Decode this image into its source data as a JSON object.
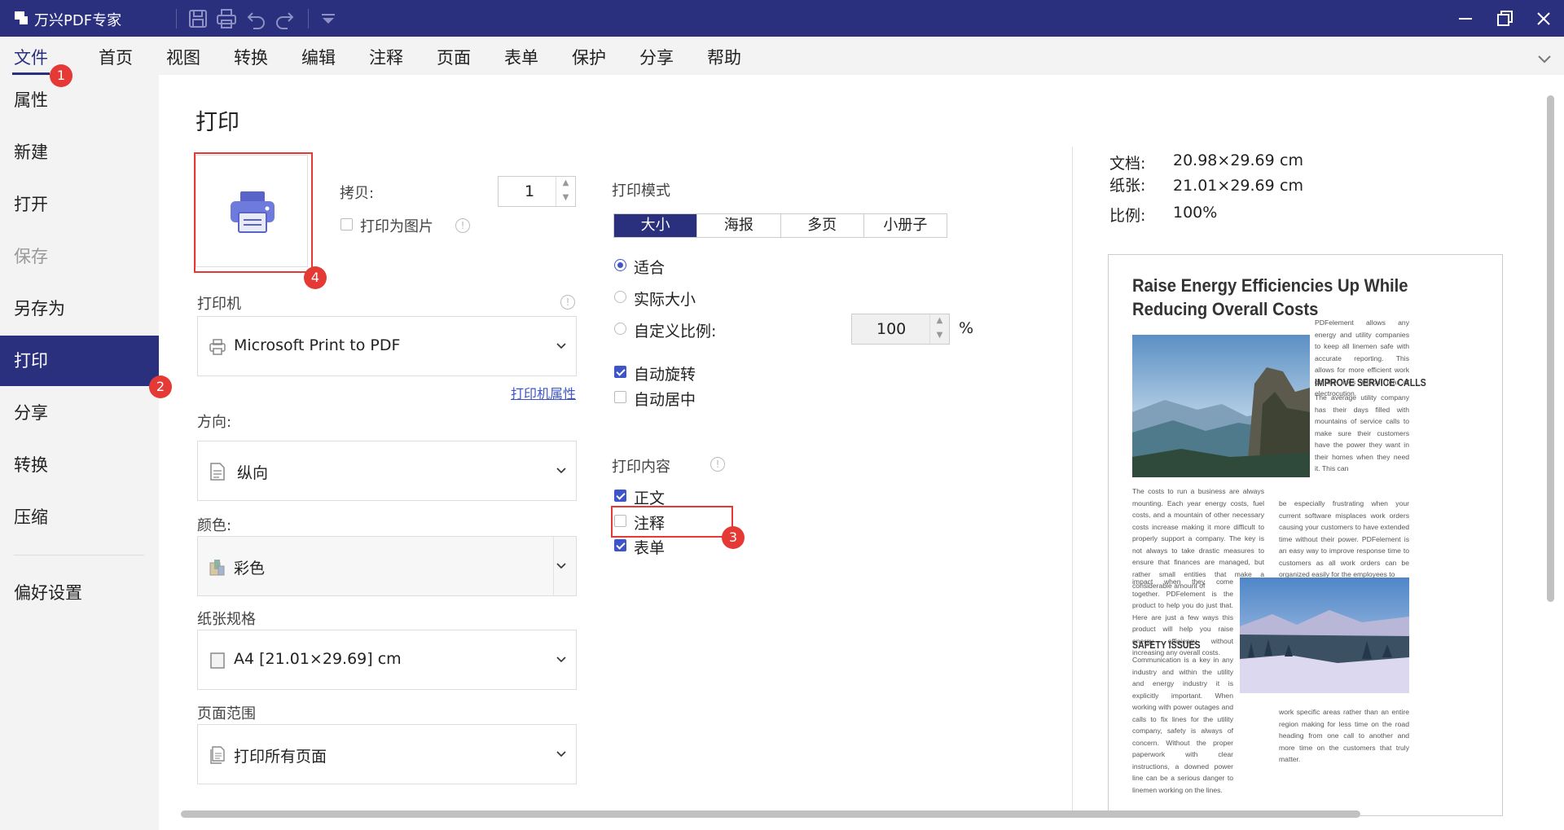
{
  "app": {
    "title": "万兴PDF专家"
  },
  "menu": [
    "文件",
    "首页",
    "视图",
    "转换",
    "编辑",
    "注释",
    "页面",
    "表单",
    "保护",
    "分享",
    "帮助"
  ],
  "sidebar": {
    "items": [
      "属性",
      "新建",
      "打开",
      "保存",
      "另存为",
      "打印",
      "分享",
      "转换",
      "压缩"
    ],
    "preferences": "偏好设置"
  },
  "badges": [
    "1",
    "2",
    "3",
    "4"
  ],
  "print": {
    "title": "打印",
    "copies_label": "拷贝:",
    "copies_value": "1",
    "print_as_image": "打印为图片",
    "printer_label": "打印机",
    "printer_value": "Microsoft Print to PDF",
    "printer_props": "打印机属性",
    "orientation_label": "方向:",
    "orientation_value": "纵向",
    "color_label": "颜色:",
    "color_value": "彩色",
    "paper_label": "纸张规格",
    "paper_value": "A4 [21.01×29.69] cm",
    "range_label": "页面范围",
    "range_value": "打印所有页面",
    "mode_label": "打印模式",
    "mode_tabs": [
      "大小",
      "海报",
      "多页",
      "小册子"
    ],
    "fit": "适合",
    "actual_size": "实际大小",
    "custom_scale": "自定义比例:",
    "scale_value": "100",
    "percent": "%",
    "auto_rotate": "自动旋转",
    "auto_center": "自动居中",
    "content_label": "打印内容",
    "content_body": "正文",
    "content_annot": "注释",
    "content_form": "表单"
  },
  "info": {
    "doc_label": "文档:",
    "doc_value": "20.98×29.69",
    "paper_label": "纸张:",
    "paper_value": "21.01×29.69",
    "unit": "cm",
    "scale_label": "比例:",
    "scale_value": "100%"
  },
  "preview": {
    "title": "Raise Energy Efficiencies Up While Reducing Overall Costs",
    "intro": "PDFelement allows any energy and utility companies to keep all linemen safe with accurate reporting. This allows for more efficient work on the lines without fear of electrocution.",
    "h_service": "IMPROVE SERVICE CALLS",
    "service_text": "The average utility company has their days filled with mountains of service calls to make sure their customers have the power they want in their homes when they need it. This can",
    "service_text2": "be especially frustrating when your current software misplaces work orders causing your customers to have extended time without their power. PDFelement is an easy way to improve response time to customers as all work orders can be organized easily for the employees to",
    "left_text": "The costs to run a business are always mounting. Each year energy costs, fuel costs, and a mountain of other necessary costs increase making it more difficult to properly support a company. The key is not always to take drastic measures to ensure that finances are managed, but rather small entities that make a considerable amount of",
    "left_text2": "impact when they come together. PDFelement is the product to help you do just that. Here are just a few ways this product will help you raise energy efficiency without increasing any overall costs.",
    "h_safety": "SAFETY ISSUES",
    "safety_text": "Communication is a key in any industry and within the utility and energy industry it is explicitly important. When working with power outages and calls to fix lines for the utility company, safety is always of concern. Without the proper paperwork with clear instructions, a downed power line can be a serious danger to linemen working on the lines.",
    "right_bottom": "work specific areas rather than an entire region making for less time on the road heading from one call to another and more time on the customers that truly matter."
  },
  "colors": {
    "accent": "#2a2f7e",
    "check": "#3d55c8",
    "badge": "#e53935"
  }
}
